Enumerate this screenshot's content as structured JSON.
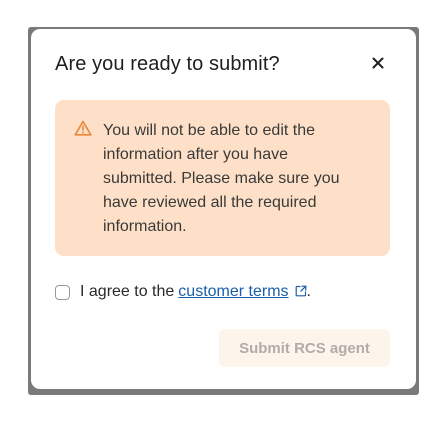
{
  "dialog": {
    "title": "Are you ready to submit?",
    "close_icon": "close-icon"
  },
  "warning": {
    "icon": "warning-triangle-icon",
    "message": "You will not be able to edit the information after you have submitted. Please make sure you have reviewed all the required information."
  },
  "agreement": {
    "checked": false,
    "prefix": "I agree to the",
    "link_text": "customer terms",
    "link_icon": "external-link-icon",
    "suffix": "."
  },
  "actions": {
    "submit_label": "Submit RCS agent",
    "submit_enabled": false
  },
  "colors": {
    "warning_bg": "#fde0c7",
    "warning_icon": "#e8863a",
    "link": "#1a5fa8",
    "disabled_button_bg": "#fdf4ec",
    "disabled_button_text": "#b3aba6"
  }
}
